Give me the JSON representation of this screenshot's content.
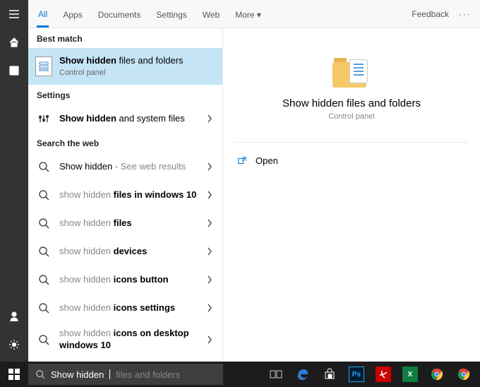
{
  "tabs": {
    "all": "All",
    "apps": "Apps",
    "documents": "Documents",
    "settings": "Settings",
    "web": "Web",
    "more": "More",
    "feedback": "Feedback"
  },
  "sections": {
    "best_match": "Best match",
    "settings": "Settings",
    "search_web": "Search the web"
  },
  "best": {
    "prefix_bold": "Show hidden",
    "suffix": " files and folders",
    "sub": "Control panel"
  },
  "settings_results": [
    {
      "prefix_bold": "Show hidden",
      "suffix": " and system files"
    }
  ],
  "web_results": [
    {
      "prefix": "Show hidden",
      "suffix_grey": " - See web results"
    },
    {
      "label_light": "show hidden ",
      "label_bold": "files in windows 10"
    },
    {
      "label_light": "show hidden ",
      "label_bold": "files"
    },
    {
      "label_light": "show hidden ",
      "label_bold": "devices"
    },
    {
      "label_light": "show hidden ",
      "label_bold": "icons button"
    },
    {
      "label_light": "show hidden ",
      "label_bold": "icons settings"
    },
    {
      "label_light": "show hidden ",
      "label_bold": "icons on desktop windows 10"
    }
  ],
  "preview": {
    "title": "Show hidden files and folders",
    "sub": "Control panel",
    "open": "Open"
  },
  "search": {
    "typed": "Show hidden",
    "hint": " files and folders"
  }
}
